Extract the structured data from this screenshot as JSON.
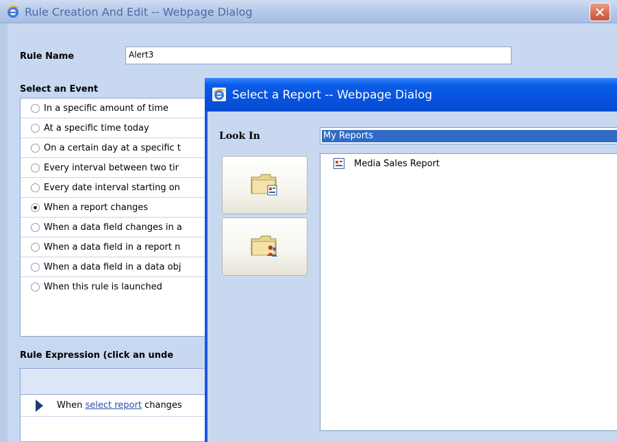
{
  "main_dialog": {
    "title": "Rule Creation And Edit -- Webpage Dialog",
    "close_glyph": "✕",
    "rule_name_label": "Rule Name",
    "rule_name_value": "Alert3",
    "select_event_heading": "Select an Event",
    "events": [
      {
        "label": "In a specific amount of time",
        "selected": false
      },
      {
        "label": "At a specific time today",
        "selected": false
      },
      {
        "label": "On a certain day at a specific t",
        "selected": false
      },
      {
        "label": "Every interval between two tir",
        "selected": false
      },
      {
        "label": "Every date interval starting on",
        "selected": false
      },
      {
        "label": "When a report changes",
        "selected": true
      },
      {
        "label": "When a data field changes in a",
        "selected": false
      },
      {
        "label": "When a data field in a report n",
        "selected": false
      },
      {
        "label": "When a data field in a data obj",
        "selected": false
      },
      {
        "label": "When this rule is launched",
        "selected": false
      }
    ],
    "expression_heading": "Rule Expression (click an unde",
    "expression": {
      "prefix": "When",
      "link": "select report",
      "suffix": "changes"
    }
  },
  "report_dialog": {
    "title": "Select a Report -- Webpage Dialog",
    "look_in_label": "Look In",
    "look_in_value": "My Reports",
    "side_buttons": [
      {
        "icon": "my-reports-folder-icon"
      },
      {
        "icon": "shared-reports-folder-icon"
      }
    ],
    "reports": [
      {
        "name": "Media Sales Report",
        "icon": "report-icon"
      }
    ]
  },
  "colors": {
    "dialog_bg": "#c8d8f0",
    "active_titlebar": "#0852de",
    "selection": "#316ac5"
  }
}
